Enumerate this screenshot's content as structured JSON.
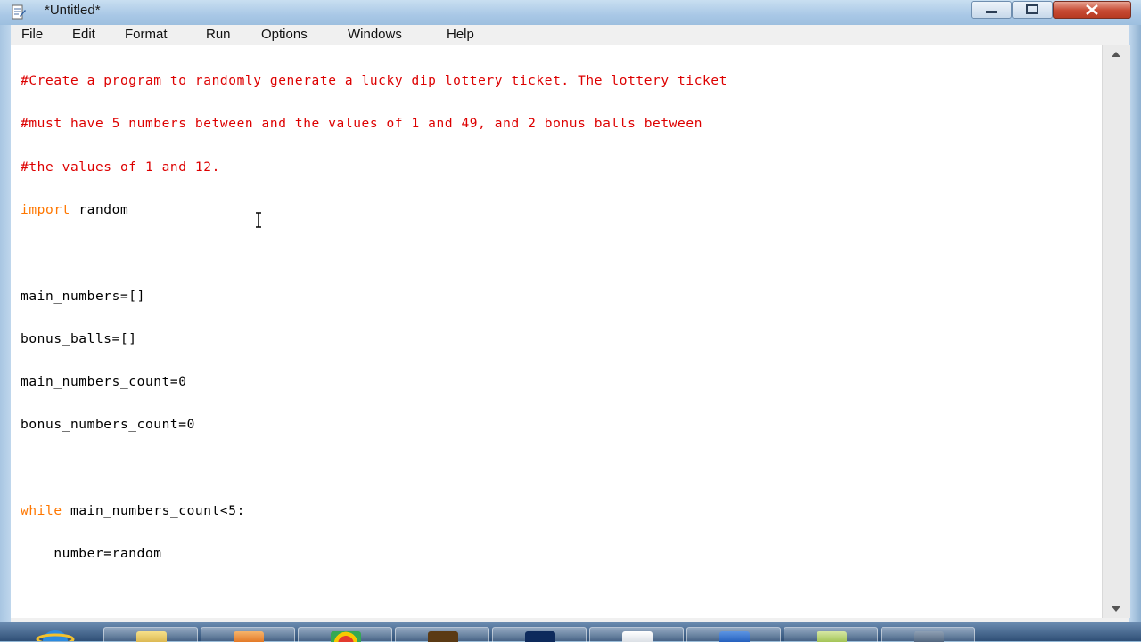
{
  "window": {
    "title": "*Untitled*"
  },
  "menu": {
    "items": [
      "File",
      "Edit",
      "Format",
      "Run",
      "Options",
      "Windows",
      "Help"
    ]
  },
  "editor": {
    "lines": [
      {
        "text": "#Create a program to randomly generate a lucky dip lottery ticket. The lottery ticket",
        "style": "comment"
      },
      {
        "text": "#must have 5 numbers between and the values of 1 and 49, and 2 bonus balls between",
        "style": "comment"
      },
      {
        "text": "#the values of 1 and 12.",
        "style": "comment"
      },
      {
        "kw": "import",
        "rest": " random"
      },
      {
        "text": ""
      },
      {
        "text": "main_numbers=[]"
      },
      {
        "text": "bonus_balls=[]"
      },
      {
        "text": "main_numbers_count=0"
      },
      {
        "text": "bonus_numbers_count=0"
      },
      {
        "text": ""
      },
      {
        "kw": "while",
        "rest": " main_numbers_count<5:"
      },
      {
        "text": "    number=random"
      }
    ]
  },
  "colors": {
    "comment": "#dd0000",
    "keyword": "#ff7700",
    "title_bar": "#a9c8e6",
    "close_button": "#c74a33"
  },
  "taskbar": {
    "icons": [
      "internet-explorer-icon",
      "file-explorer-icon",
      "media-player-icon",
      "chrome-icon",
      "bridge-icon",
      "photoshop-icon",
      "document-icon",
      "word-icon",
      "mail-icon",
      "python-icon"
    ]
  }
}
